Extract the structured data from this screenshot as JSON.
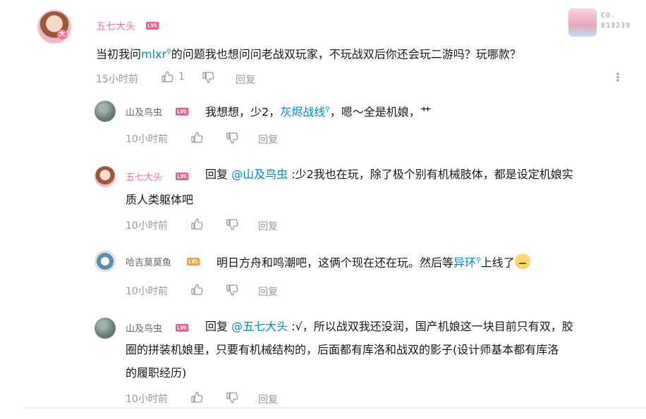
{
  "main_comment": {
    "username": "五七大头",
    "level": "LV6",
    "text_before_link": "当初我问",
    "link_text": "mlxr",
    "text_after_link": "的问题我也想问问老战双玩家，不玩战双后你还会玩二游吗？玩哪款？",
    "time": "15小时前",
    "like_count": "1",
    "reply_label": "回复",
    "decoration_label": "CO.",
    "decoration_number": "013239"
  },
  "replies": [
    {
      "username": "山及鸟虫",
      "level": "LV6",
      "text_before_link": "我想想，少2，",
      "link_text": "灰烬战线",
      "text_after_link": "，嗯～全是机娘，",
      "tail": "艹",
      "time": "10小时前",
      "reply_label": "回复"
    },
    {
      "username": "五七大头",
      "level": "LV6",
      "prefix": "回复 ",
      "mention": "@山及鸟虫",
      "text_line1": " :少2我也在玩，除了极个别有机械肢体，都是设定机娘实",
      "text_line2": "质人类躯体吧",
      "time": "10小时前",
      "reply_label": "回复"
    },
    {
      "username": "哈吉莫莫鱼",
      "level": "LV5",
      "text_before_link": "明日方舟和鸣潮吧，这俩个现在还在玩。然后等",
      "link_text": "异环",
      "text_after_link": "上线了",
      "time": "10小时前",
      "reply_label": "回复"
    },
    {
      "username": "山及鸟虫",
      "level": "LV6",
      "prefix": "回复 ",
      "mention": "@五七大头",
      "text_line1": " :√，所以战双我还没润，国产机娘这一块目前只有双，胶",
      "text_line2": "圈的拼装机娘里，只要有机械结构的，后面都有库洛和战双的影子(设计师基本都有库洛",
      "text_line3": "的履职经历)",
      "time": "10小时前",
      "reply_label": "回复"
    }
  ],
  "colors": {
    "vip_name": "#fb7299",
    "link": "#008ac5",
    "meta": "#9499a0",
    "lv6": "#f25d8e",
    "lv5": "#ff9c3a"
  },
  "icons": {
    "like": "thumbs-up-icon",
    "dislike": "thumbs-down-icon",
    "more": "more-vertical-icon",
    "search": "search-icon"
  }
}
